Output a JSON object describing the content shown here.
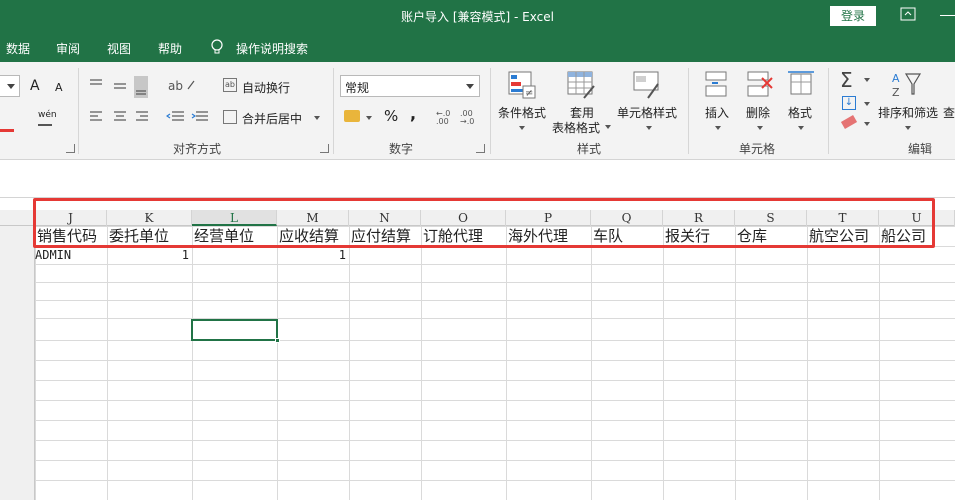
{
  "window": {
    "title": "账户导入  [兼容模式]  -  Excel",
    "login_label": "登录"
  },
  "tabs": [
    {
      "label": "数据"
    },
    {
      "label": "审阅"
    },
    {
      "label": "视图"
    },
    {
      "label": "帮助"
    }
  ],
  "tell_me": {
    "label": "操作说明搜索",
    "icon": "lightbulb-icon"
  },
  "ribbon": {
    "font": {
      "grow_label": "A",
      "shrink_label": "A",
      "phonetic_label": "wén"
    },
    "alignment": {
      "group_label": "对齐方式",
      "wrap_text_label": "自动换行",
      "merge_label": "合并后居中"
    },
    "number": {
      "group_label": "数字",
      "format_value": "常规",
      "percent_label": "%",
      "comma_label": ","
    },
    "styles": {
      "group_label": "样式",
      "conditional_label": "条件格式",
      "table_label_1": "套用",
      "table_label_2": "表格格式",
      "cell_styles_label": "单元格样式"
    },
    "cells": {
      "group_label": "单元格",
      "insert_label": "插入",
      "delete_label": "删除",
      "format_label": "格式"
    },
    "editing": {
      "group_label": "编辑",
      "sort_filter_label": "排序和筛选",
      "find_label": "查"
    }
  },
  "sheet": {
    "columns": [
      "J",
      "K",
      "L",
      "M",
      "N",
      "O",
      "P",
      "Q",
      "R",
      "S",
      "T",
      "U"
    ],
    "header_row": [
      "销售代码",
      "委托单位",
      "经营单位",
      "应收结算",
      "应付结算",
      "订舱代理",
      "海外代理",
      "车队",
      "报关行",
      "仓库",
      "航空公司",
      "船公司"
    ],
    "data_row": [
      "ADMIN",
      "1",
      "",
      "1",
      "",
      "",
      "",
      "",
      "",
      "",
      "",
      ""
    ],
    "selected_column": "L",
    "colors": {
      "accent": "#217346",
      "highlight_box": "#e53935"
    }
  }
}
